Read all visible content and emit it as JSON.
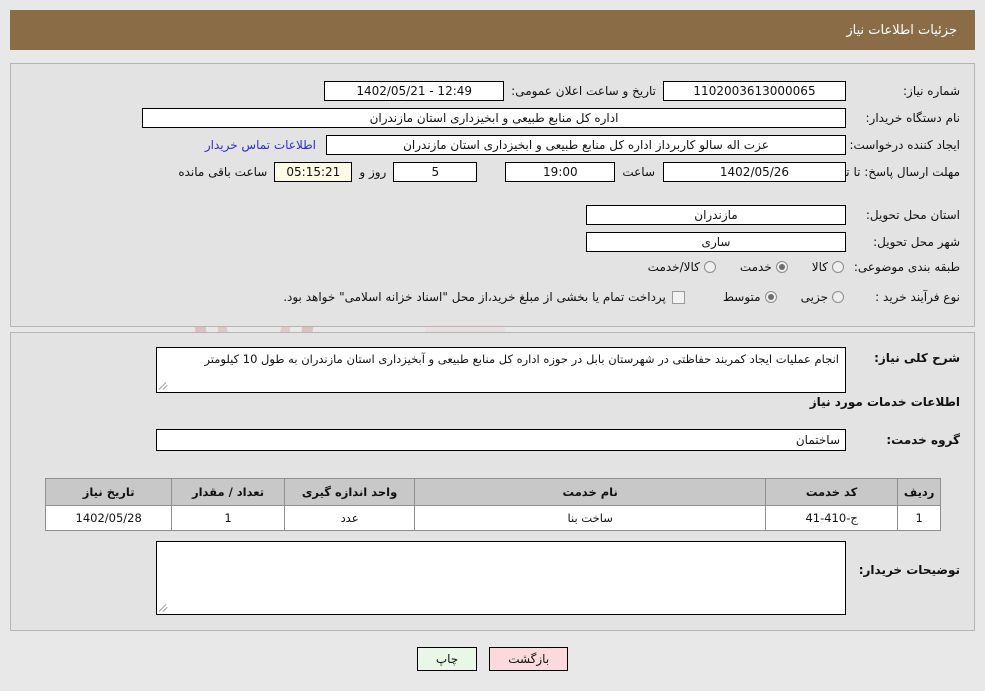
{
  "header": {
    "title": "جزئیات اطلاعات نیاز",
    "bar_color": "#8a6d46"
  },
  "watermark": {
    "text": "AriaTender.net",
    "shield_color": "#c98b8b",
    "arrow_color": "#e3b6b6"
  },
  "main": {
    "need_number": {
      "label": "شماره نیاز:",
      "value": "1102003613000065"
    },
    "announce_datetime": {
      "label": "تاریخ و ساعت اعلان عمومی:",
      "value": "1402/05/21 - 12:49"
    },
    "buyer_org": {
      "label": "نام دستگاه خریدار:",
      "value": "اداره کل منابع طبیعی و ابخیزداری استان مازندران"
    },
    "requester": {
      "label": "ایجاد کننده درخواست:",
      "value": "عزت اله سالو کاربرداز اداره کل منابع طبیعی و ابخیزداری استان مازندران"
    },
    "contact_link": "اطلاعات تماس خریدار",
    "deadline": {
      "label": "مهلت ارسال پاسخ: تا تاریخ:",
      "date": "1402/05/26",
      "time_label": "ساعت",
      "time": "19:00",
      "days_value": "5",
      "days_label": "روز و",
      "countdown": "05:15:21",
      "remaining_label": "ساعت باقی مانده"
    },
    "province": {
      "label": "استان محل تحویل:",
      "value": "مازندران"
    },
    "city": {
      "label": "شهر محل تحویل:",
      "value": "ساری"
    },
    "subject_classification": {
      "label": "طبقه بندی موضوعی:",
      "options": [
        {
          "label": "کالا",
          "selected": false
        },
        {
          "label": "خدمت",
          "selected": true
        },
        {
          "label": "کالا/خدمت",
          "selected": false
        }
      ]
    },
    "purchase_process": {
      "label": "نوع فرآیند خرید :",
      "options": [
        {
          "label": "جزیی",
          "selected": false
        },
        {
          "label": "متوسط",
          "selected": true
        }
      ],
      "treasury_checkbox": {
        "checked": false,
        "label": "پرداخت تمام یا بخشی از مبلغ خرید،از محل \"اسناد خزانه اسلامی\" خواهد بود."
      }
    }
  },
  "description": {
    "need_summary": {
      "label": "شرح کلی نیاز:",
      "value": "انجام عملیات ایجاد کمربند حفاظتی در شهرستان بابل در حوزه اداره کل منابع طبیعی و آبخیزداری استان مازندران به طول 10 کیلومتر"
    },
    "services_section_title": "اطلاعات خدمات مورد نیاز",
    "service_group": {
      "label": "گروه خدمت:",
      "value": "ساختمان"
    },
    "buyer_notes": {
      "label": "توضیحات خریدار:",
      "value": ""
    }
  },
  "table": {
    "columns": [
      "ردیف",
      "کد خدمت",
      "نام خدمت",
      "واحد اندازه گیری",
      "تعداد / مقدار",
      "تاریخ نیاز"
    ],
    "rows": [
      {
        "row_no": "1",
        "service_code": "ج-410-41",
        "service_name": "ساخت بنا",
        "unit": "عدد",
        "quantity": "1",
        "need_date": "1402/05/28"
      }
    ]
  },
  "buttons": {
    "print": "چاپ",
    "back": "بازگشت"
  }
}
